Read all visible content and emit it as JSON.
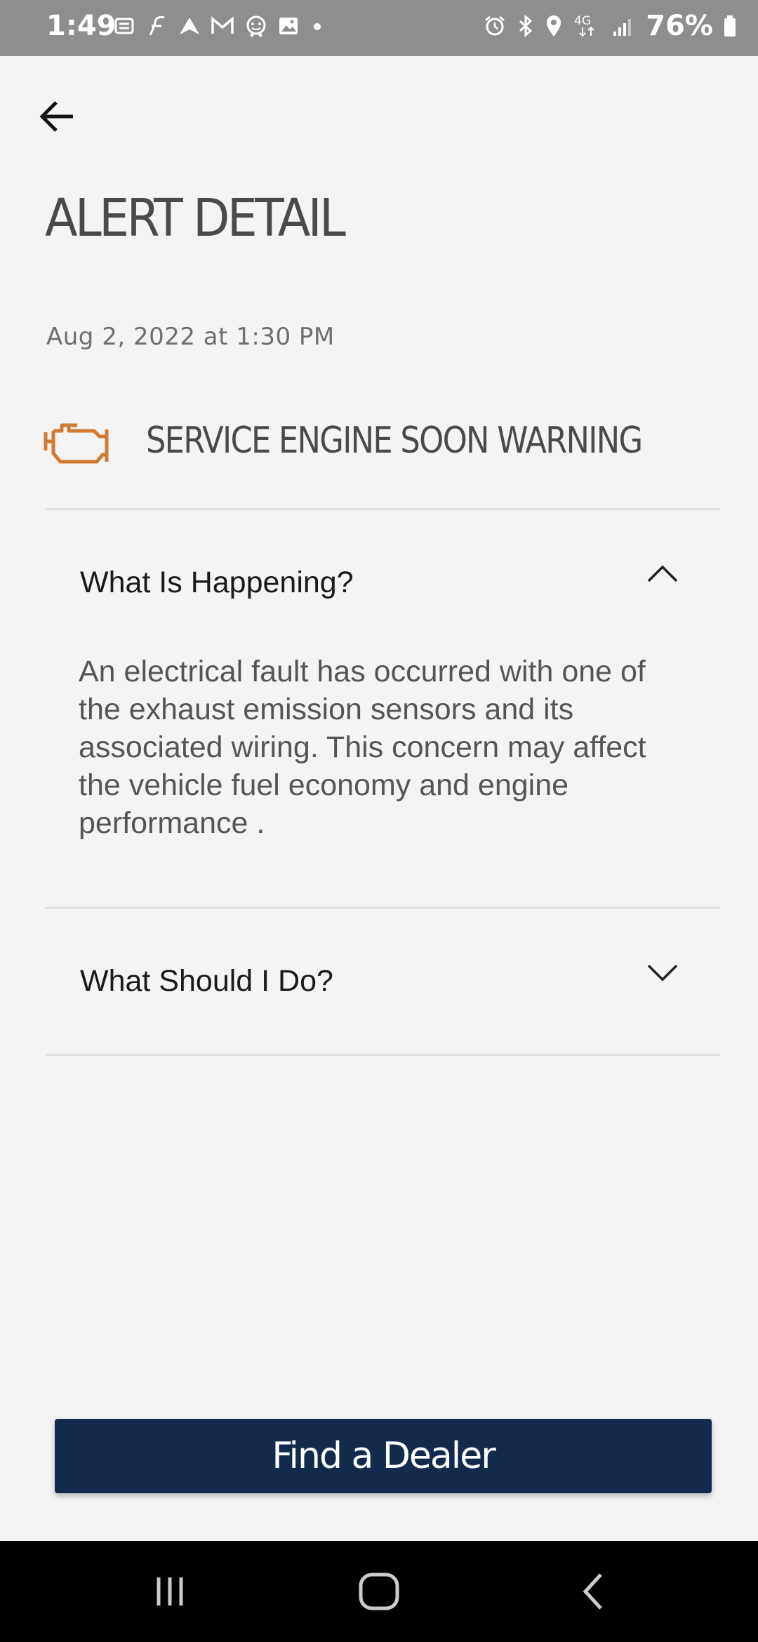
{
  "status_bar": {
    "time": "1:49",
    "left_icons": [
      "notification-icon",
      "app-f-icon",
      "arrow-up-icon",
      "gmail-icon",
      "waze-icon",
      "gallery-icon",
      "dot-icon"
    ],
    "right_icons": [
      "alarm-icon",
      "bluetooth-icon",
      "location-icon",
      "lte-icon",
      "signal-icon"
    ],
    "network": "4G",
    "battery": "76%"
  },
  "header": {
    "back_icon": "arrow-left-icon",
    "title": "ALERT DETAIL"
  },
  "alert": {
    "timestamp": "Aug 2, 2022 at 1:30 PM",
    "icon": "engine-warning-icon",
    "icon_color": "#d07a33",
    "title": "SERVICE ENGINE SOON WARNING"
  },
  "sections": [
    {
      "label": "What Is Happening?",
      "expanded": true,
      "chevron": "chevron-up-icon",
      "body": "An electrical fault has occurred with one of the exhaust emission sensors and its associated wiring. This concern may affect the vehicle fuel economy and engine performance ."
    },
    {
      "label": "What Should I Do?",
      "expanded": false,
      "chevron": "chevron-down-icon"
    }
  ],
  "actions": {
    "find_dealer_label": "Find a Dealer",
    "button_color": "#142a4d"
  },
  "nav_bar": {
    "buttons": [
      "recent-apps-icon",
      "home-icon",
      "back-icon"
    ]
  }
}
